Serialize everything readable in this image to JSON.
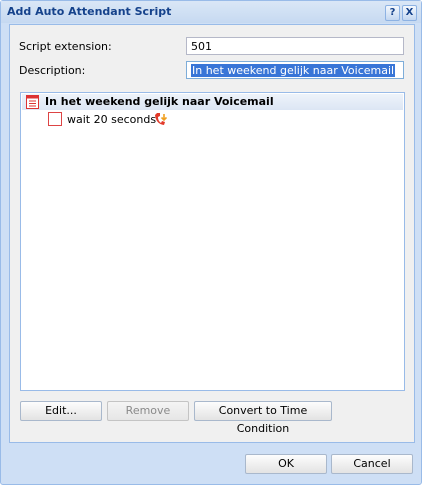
{
  "window": {
    "title": "Add Auto Attendant Script",
    "help_icon": "help-icon",
    "close_icon": "close-icon",
    "help_label": "?",
    "close_label": "X"
  },
  "form": {
    "extension_label": "Script extension:",
    "extension_value": "501",
    "description_label": "Description:",
    "description_value": "In het weekend gelijk naar Voicemail"
  },
  "tree": {
    "root_label": "In het weekend gelijk naar Voicemail",
    "root_icon": "list-icon",
    "items": [
      {
        "label": "wait 20 seconds",
        "icon": "phone-hangup-icon"
      }
    ]
  },
  "buttons": {
    "edit": "Edit...",
    "remove": "Remove",
    "convert": "Convert to Time Condition",
    "ok": "OK",
    "cancel": "Cancel"
  }
}
